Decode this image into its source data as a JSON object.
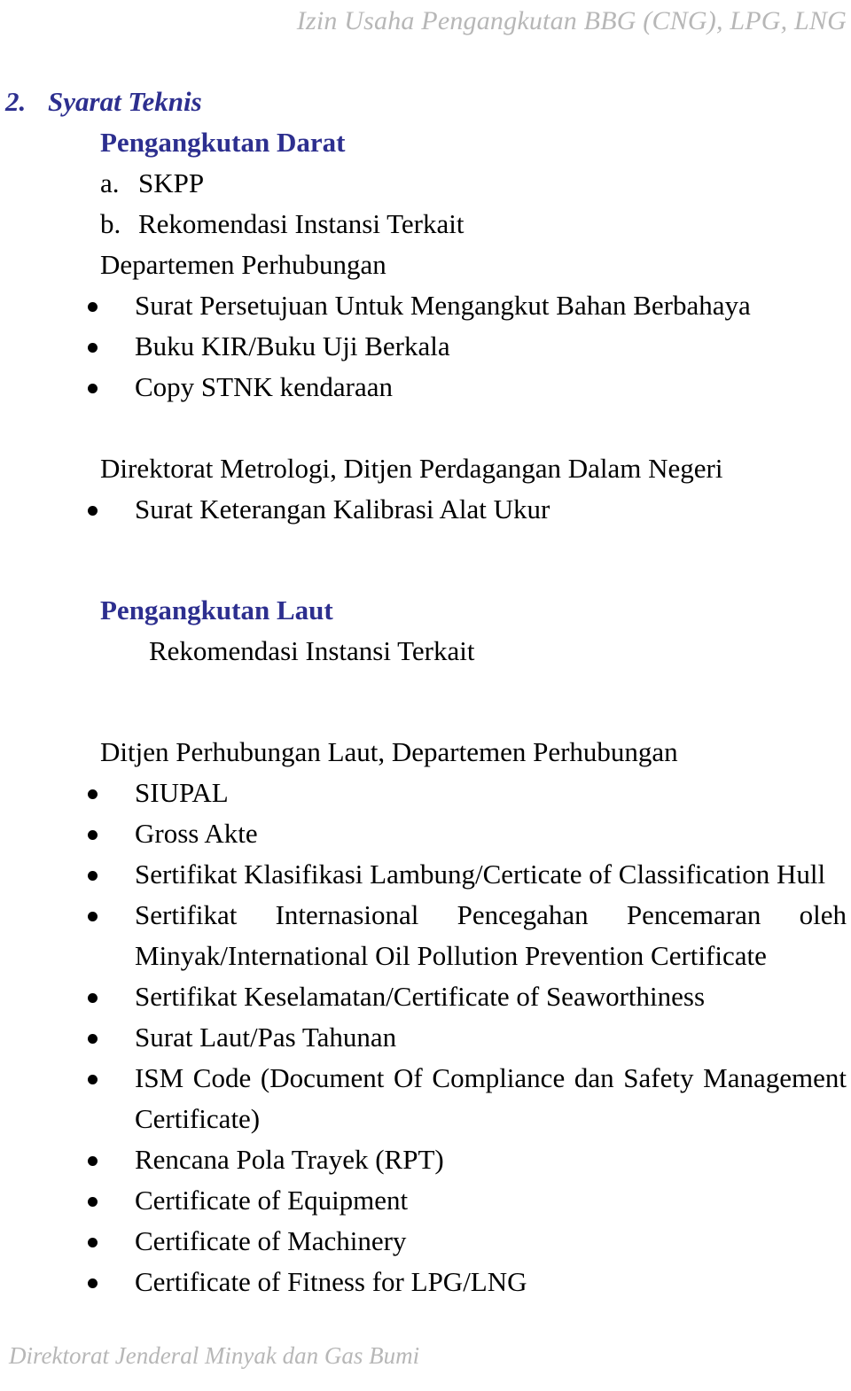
{
  "header": {
    "running_title": "Izin Usaha Pengangkutan BBG (CNG), LPG, LNG"
  },
  "footer": {
    "text": "Direktorat Jenderal Minyak dan Gas Bumi"
  },
  "section": {
    "number": "2.",
    "title": "Syarat Teknis"
  },
  "darat": {
    "heading": "Pengangkutan Darat",
    "items": [
      {
        "letter": "a.",
        "label": "SKPP"
      },
      {
        "letter": "b.",
        "label": "Rekomendasi Instansi Terkait"
      }
    ],
    "agency_1": "Departemen Perhubungan",
    "agency_1_bullets": [
      "Surat Persetujuan Untuk Mengangkut Bahan Berbahaya",
      "Buku KIR/Buku Uji Berkala",
      "Copy STNK kendaraan"
    ],
    "agency_2": "Direktorat Metrologi, Ditjen Perdagangan Dalam Negeri",
    "agency_2_bullets": [
      "Surat Keterangan Kalibrasi Alat Ukur"
    ]
  },
  "laut": {
    "heading": "Pengangkutan Laut",
    "subheading": "Rekomendasi Instansi Terkait",
    "agency_1": "Ditjen Perhubungan Laut, Departemen Perhubungan",
    "agency_1_bullets": [
      "SIUPAL",
      "Gross Akte",
      "Sertifikat Klasifikasi Lambung/Certicate of Classification Hull",
      "Sertifikat Internasional Pencegahan Pencemaran oleh Minyak/International Oil Pollution Prevention Certificate",
      "Sertifikat Keselamatan/Certificate of Seaworthiness",
      "Surat Laut/Pas Tahunan",
      "ISM Code (Document Of Compliance dan Safety Management Certificate)",
      "Rencana Pola Trayek (RPT)",
      "Certificate of Equipment",
      "Certificate of Machinery",
      "Certificate of Fitness for LPG/LNG"
    ]
  },
  "colors": {
    "heading_navy": "#2d2f8f",
    "body_black": "#000000",
    "chrome_gray": "#b7b7b7"
  }
}
